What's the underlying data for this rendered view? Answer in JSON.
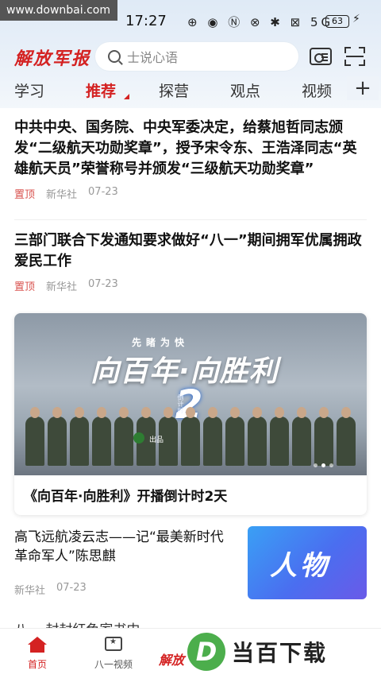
{
  "status_bar": {
    "watermark": "www.downbai.com",
    "time": "17:27",
    "icons": "⊕ ◉ Ⓝ ⊗ ✱ ⊠ 5G",
    "battery": "63"
  },
  "header": {
    "logo_text": "解放军报",
    "search_placeholder": "士说心语"
  },
  "tabs": {
    "items": [
      "学习",
      "推荐",
      "探营",
      "观点",
      "视频"
    ],
    "plus": "+"
  },
  "feed": {
    "item1": {
      "title": "中共中央、国务院、中央军委决定，给蔡旭哲同志颁发“二级航天功勋奖章”，授予宋令东、王浩泽同志“英雄航天员”荣誉称号并颁发“三级航天功勋奖章”",
      "pin": "置顶",
      "source": "新华社",
      "date": "07-23"
    },
    "item2": {
      "title": "三部门联合下发通知要求做好“八一”期间拥军优属拥政爱民工作",
      "pin": "置顶",
      "source": "新华社",
      "date": "07-23"
    },
    "banner": {
      "subtitle": "先睹为快",
      "big_text": "向百年·向胜利",
      "count": "2",
      "count_label": "倒计时",
      "producer": "出品",
      "title": "《向百年·向胜利》开播倒计时2天"
    },
    "item3": {
      "title": "高飞远航凌云志——记“最美新时代革命军人”陈思麒",
      "source": "新华社",
      "date": "07-23",
      "thumb_text": "人物"
    },
    "partial_title": "八一 封封红色家书中"
  },
  "bottom_nav": {
    "home": "首页",
    "video": "八一视频",
    "center_logo": "解放"
  },
  "watermark_bottom": {
    "letter": "D",
    "text": "当百下载"
  }
}
